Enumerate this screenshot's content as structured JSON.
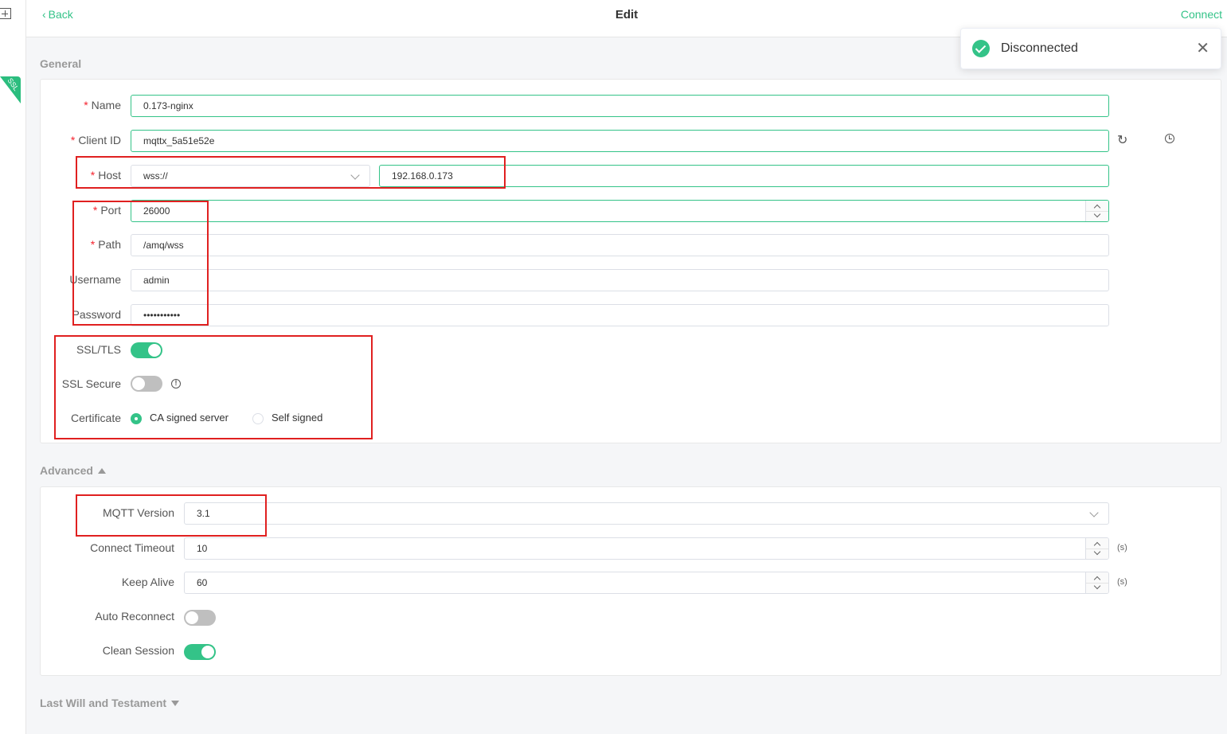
{
  "header": {
    "back_label": "Back",
    "title": "Edit",
    "connect_label": "Connect"
  },
  "sidebar": {
    "ssl_badge": "SSL"
  },
  "toast": {
    "message": "Disconnected"
  },
  "general": {
    "section_title": "General",
    "name": {
      "label": "Name",
      "value": "0.173-nginx"
    },
    "client_id": {
      "label": "Client ID",
      "value": "mqttx_5a51e52e"
    },
    "host": {
      "label": "Host",
      "protocol": "wss://",
      "value": "192.168.0.173"
    },
    "port": {
      "label": "Port",
      "value": "26000"
    },
    "path": {
      "label": "Path",
      "value": "/amq/wss"
    },
    "username": {
      "label": "Username",
      "value": "admin"
    },
    "password": {
      "label": "Password",
      "value": "•••••••••••"
    },
    "ssl_tls": {
      "label": "SSL/TLS",
      "on": true
    },
    "ssl_secure": {
      "label": "SSL Secure",
      "on": false
    },
    "certificate": {
      "label": "Certificate",
      "options": [
        "CA signed server",
        "Self signed"
      ],
      "selected": "CA signed server"
    }
  },
  "advanced": {
    "section_title": "Advanced",
    "mqtt_version": {
      "label": "MQTT Version",
      "value": "3.1"
    },
    "connect_timeout": {
      "label": "Connect Timeout",
      "value": "10",
      "unit": "(s)"
    },
    "keep_alive": {
      "label": "Keep Alive",
      "value": "60",
      "unit": "(s)"
    },
    "auto_reconnect": {
      "label": "Auto Reconnect",
      "on": false
    },
    "clean_session": {
      "label": "Clean Session",
      "on": true
    }
  },
  "last_will": {
    "section_title": "Last Will and Testament"
  },
  "colors": {
    "accent": "#34c388",
    "annotation": "#e02020",
    "required": "#f5222d"
  }
}
